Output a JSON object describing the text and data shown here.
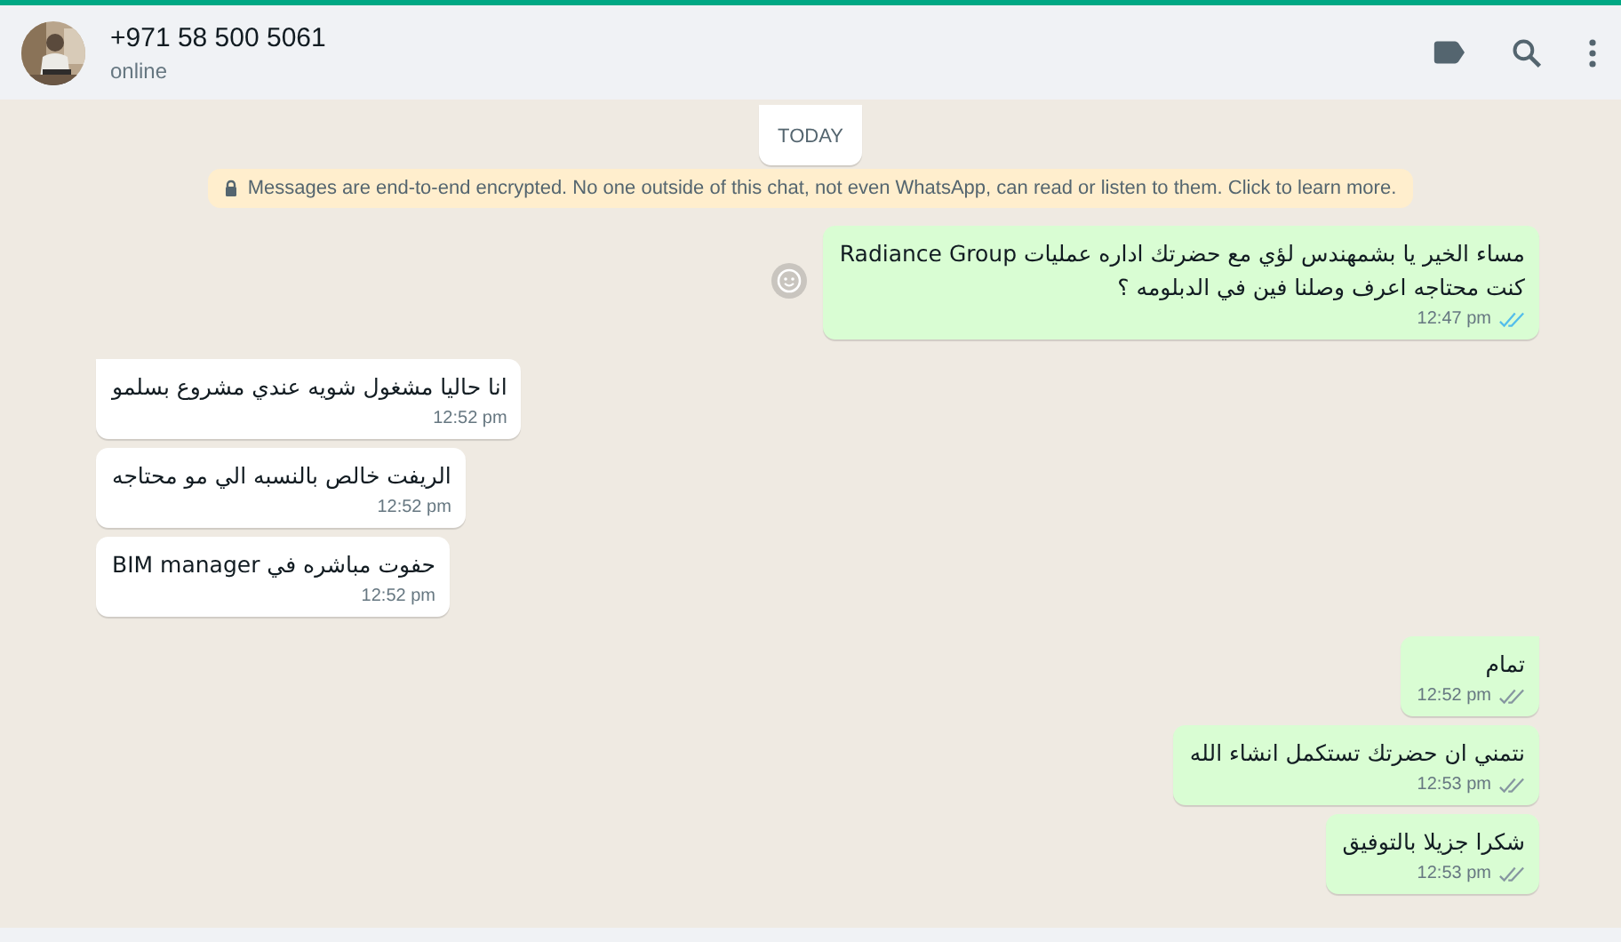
{
  "header": {
    "title": "+971 58 500 5061",
    "status": "online"
  },
  "date_chip": "TODAY",
  "encryption_notice": "Messages are end-to-end encrypted. No one outside of this chat, not even WhatsApp, can read or listen to them. Click to learn more.",
  "messages": [
    {
      "kind": "out",
      "text": "مساء الخير يا بشمهندس لؤي مع حضرتك اداره عمليات Radiance Group\nكنت محتاجه اعرف وصلنا فين في الدبلومه  ؟",
      "time": "12:47 pm",
      "read": true,
      "reaction_button": true
    },
    {
      "kind": "in",
      "text": "انا حاليا مشغول شويه عندي مشروع بسلمو",
      "time": "12:52 pm",
      "tail": true
    },
    {
      "kind": "in",
      "text": "الريفت خالص بالنسبه الي مو محتاجه",
      "time": "12:52 pm",
      "tail": false
    },
    {
      "kind": "in",
      "text": "حفوت مباشره في BIM manager",
      "time": "12:52 pm",
      "tail": false
    },
    {
      "kind": "out",
      "text": "تمام",
      "time": "12:52 pm",
      "read": false,
      "tail": true
    },
    {
      "kind": "out",
      "text": "نتمني ان حضرتك تستكمل انشاء الله",
      "time": "12:53 pm",
      "read": false,
      "tail": false
    },
    {
      "kind": "out",
      "text": "شكرا جزيلا بالتوفيق",
      "time": "12:53 pm",
      "read": false,
      "tail": false
    }
  ]
}
